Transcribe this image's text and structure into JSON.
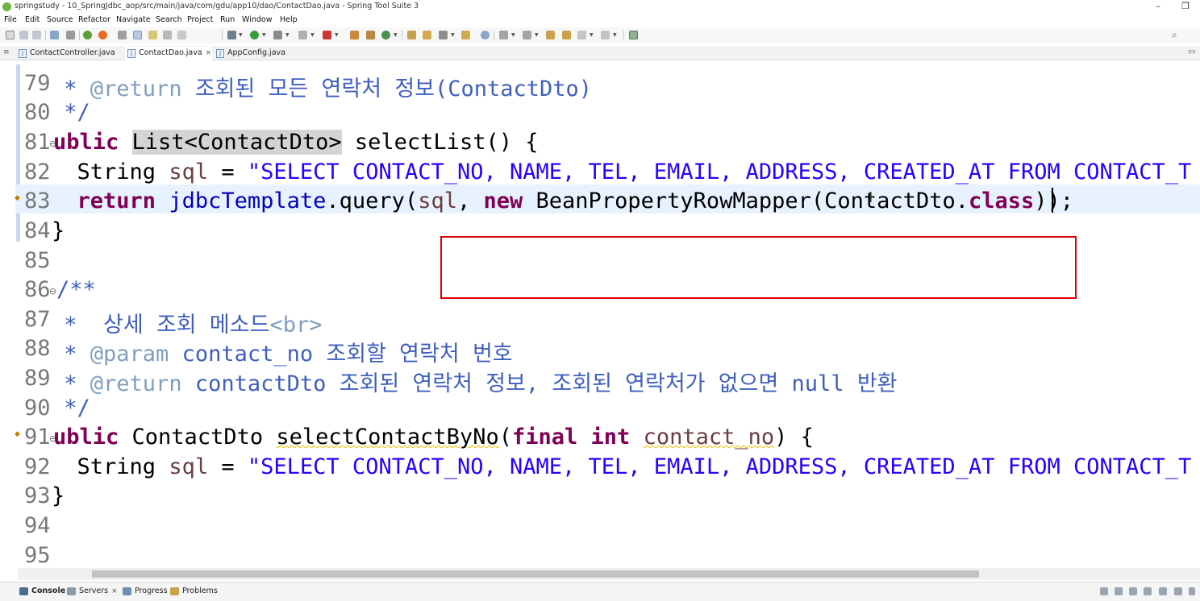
{
  "window": {
    "title": "springstudy - 10_SpringJdbc_aop/src/main/java/com/gdu/app10/dao/ContactDao.java - Spring Tool Suite 3",
    "minimize": "–",
    "restore": "❐"
  },
  "menubar": [
    "File",
    "Edit",
    "Source",
    "Refactor",
    "Navigate",
    "Search",
    "Project",
    "Run",
    "Window",
    "Help"
  ],
  "editor_tabs": [
    {
      "label": "ContactController.java",
      "active": false,
      "icon": "java-file-icon"
    },
    {
      "label": "ContactDao.java",
      "active": true,
      "icon": "java-file-icon",
      "close": "×"
    },
    {
      "label": "AppConfig.java",
      "active": false,
      "icon": "java-file-icon"
    }
  ],
  "code": {
    "lines": [
      {
        "num": "79",
        "text": " * @return 조회된 모든 연락처 정보(ContactDto)"
      },
      {
        "num": "80",
        "text": " */"
      },
      {
        "num": "81",
        "text": "public List<ContactDto> selectList() {"
      },
      {
        "num": "82",
        "text": "  String sql = \"SELECT CONTACT_NO, NAME, TEL, EMAIL, ADDRESS, CREATED_AT FROM CONTACT_T OR"
      },
      {
        "num": "83",
        "text": "  return jdbcTemplate.query(sql, new BeanPropertyRowMapper(ContactDto.class));"
      },
      {
        "num": "84",
        "text": "}"
      },
      {
        "num": "85",
        "text": ""
      },
      {
        "num": "86",
        "text": "/**"
      },
      {
        "num": "87",
        "text": " * 상세 조회 메소드<br>"
      },
      {
        "num": "88",
        "text": " * @param contact_no 조회할 연락처 번호"
      },
      {
        "num": "89",
        "text": " * @return contactDto 조회된 연락처 정보, 조회된 연락처가 없으면 null 반환"
      },
      {
        "num": "90",
        "text": " */"
      },
      {
        "num": "91",
        "text": "public ContactDto selectContactByNo(final int contact_no) {"
      },
      {
        "num": "92",
        "text": "  String sql = \"SELECT CONTACT_NO, NAME, TEL, EMAIL, ADDRESS, CREATED_AT FROM CONTACT_T WH"
      },
      {
        "num": "93",
        "text": "}"
      },
      {
        "num": "94",
        "text": ""
      },
      {
        "num": "95",
        "text": ""
      }
    ],
    "tokens": {
      "doc_star": " * ",
      "at_return": "@return",
      "at_param": "@param",
      "l79_rest": " 조회된 모든 연락처 정보(ContactDto)",
      "doc_end": " */",
      "kw_public_cut": "ublic",
      "p_prefix": "p",
      "l81_type": "List<ContactDto>",
      "l81_rest": " selectList() {",
      "indent": "  ",
      "type_string": "String",
      "var_sql": "sql",
      "eq": " = ",
      "l82_str": "\"SELECT CONTACT_NO, NAME, TEL, EMAIL, ADDRESS, CREATED_AT FROM CONTACT_T OR",
      "kw_return": "return",
      "field_jdbc": "jdbcTemplate",
      "l83_mid1": ".query(",
      "l83_mid2": ", ",
      "kw_new": "new",
      "l83_mid3": " BeanPropertyRowMapper(ContactDto.",
      "kw_class": "class",
      "l83_end": "));",
      "brace_close": "}",
      "doc_open": "/**",
      "l87_text": " 상세 조회 메소드",
      "l87_tag": "<br>",
      "l88_rest": " contact_no 조회할 연락처 번호",
      "l89_rest": " contactDto 조회된 연락처 정보, 조회된 연락처가 없으면 null 반환",
      "l91_type": " ContactDto ",
      "l91_method": "selectContactByNo",
      "paren_open": "(",
      "kw_final": "final",
      "kw_int": "int",
      "var_contact_no": "contact_no",
      "l91_end": ") {",
      "l92_str": "\"SELECT CONTACT_NO, NAME, TEL, EMAIL, ADDRESS, CREATED_AT FROM CONTACT_T WH",
      "space": " "
    }
  },
  "bottom_tabs": [
    {
      "label": "Console",
      "active": true
    },
    {
      "label": "Servers",
      "close": "×"
    },
    {
      "label": "Progress"
    },
    {
      "label": "Problems"
    }
  ],
  "colors": {
    "keyword": "#7f0055",
    "string": "#2a00ff",
    "javadoc": "#3f5fbf",
    "javadoc_tag": "#7f9fbf",
    "field": "#0000c0",
    "local_var": "#6a3e3e",
    "annotation_box": "#e00000"
  }
}
